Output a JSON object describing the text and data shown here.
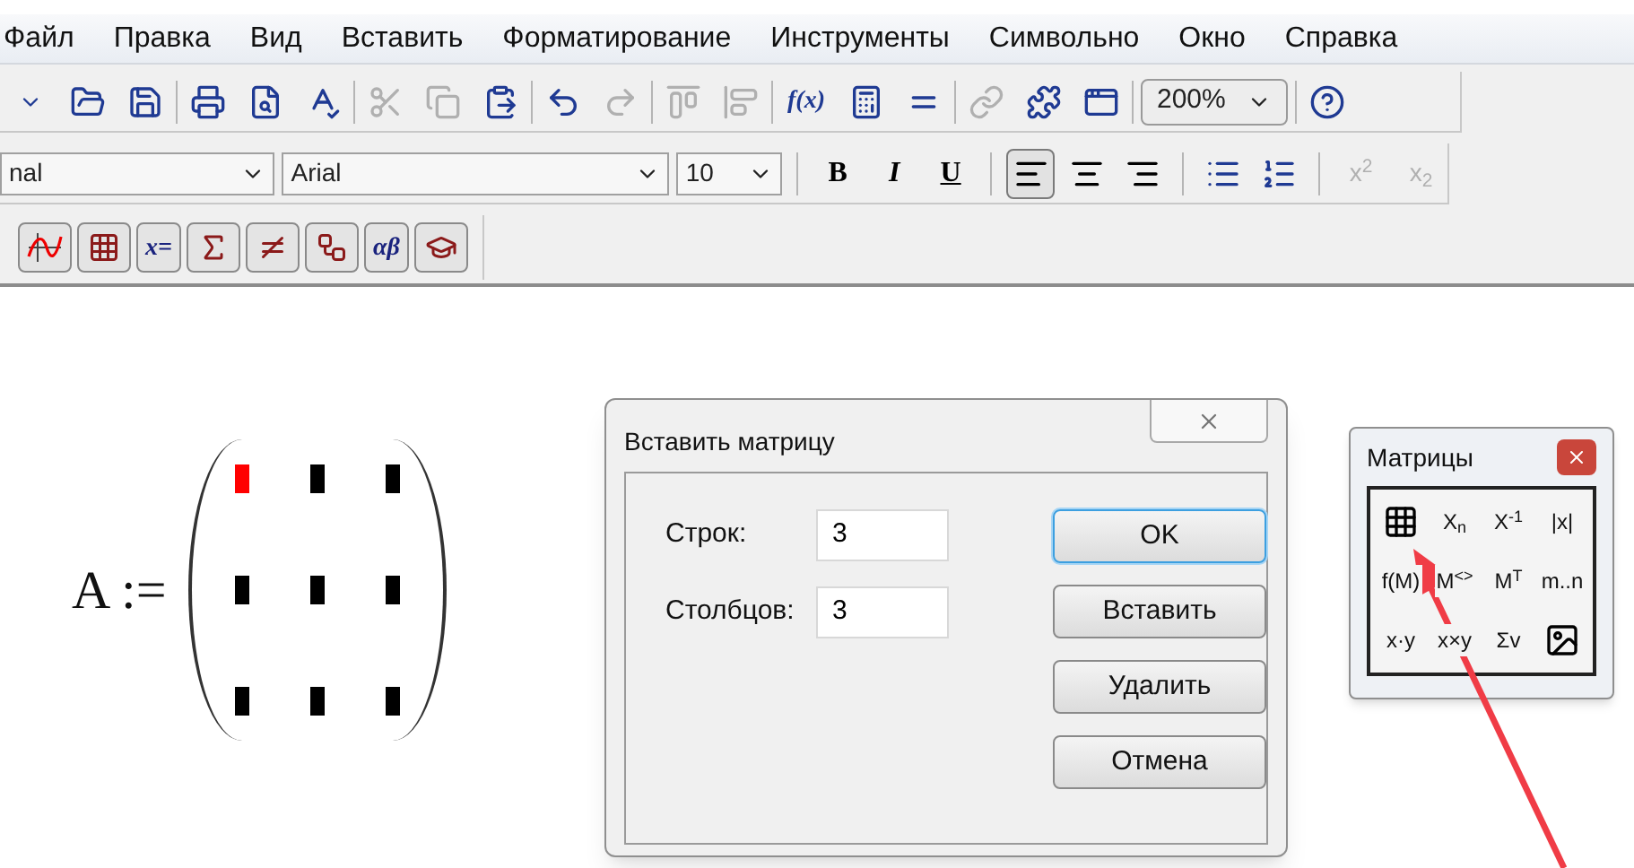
{
  "menu": [
    "Файл",
    "Правка",
    "Вид",
    "Вставить",
    "Форматирование",
    "Инструменты",
    "Символьно",
    "Окно",
    "Справка"
  ],
  "standard_toolbar": {
    "groups": [
      [
        {
          "kind": "dropdown",
          "disabled": false
        },
        {
          "kind": "open",
          "disabled": false
        },
        {
          "kind": "save",
          "disabled": false
        }
      ],
      [
        {
          "kind": "print",
          "disabled": false
        },
        {
          "kind": "preview",
          "disabled": false
        },
        {
          "kind": "spell",
          "disabled": false
        }
      ],
      [
        {
          "kind": "cut",
          "disabled": true
        },
        {
          "kind": "copy",
          "disabled": true
        },
        {
          "kind": "paste",
          "disabled": false
        }
      ],
      [
        {
          "kind": "undo",
          "disabled": false
        },
        {
          "kind": "redo",
          "disabled": true
        }
      ],
      [
        {
          "kind": "align_top",
          "disabled": true
        },
        {
          "kind": "align_left",
          "disabled": true
        }
      ],
      [
        {
          "kind": "text",
          "label": "f(x)",
          "disabled": false
        },
        {
          "kind": "resource",
          "disabled": false
        },
        {
          "kind": "equal",
          "disabled": false
        }
      ],
      [
        {
          "kind": "link",
          "disabled": true
        },
        {
          "kind": "component",
          "disabled": false
        },
        {
          "kind": "region",
          "disabled": false
        }
      ],
      [
        {
          "kind": "combo",
          "value": "200%",
          "disabled": false
        }
      ],
      [
        {
          "kind": "help",
          "disabled": false
        }
      ]
    ]
  },
  "formatting_toolbar": {
    "style": "nal",
    "font": "Arial",
    "size": "10",
    "text_buttons": [
      {
        "kind": "bold",
        "label": "B"
      },
      {
        "kind": "italic",
        "label": "I"
      },
      {
        "kind": "underline",
        "label": "U"
      }
    ],
    "align": [
      {
        "kind": "left",
        "selected": true
      },
      {
        "kind": "center",
        "selected": false
      },
      {
        "kind": "right",
        "selected": false
      }
    ],
    "lists": [
      {
        "kind": "bullets"
      },
      {
        "kind": "numbers"
      }
    ],
    "script": [
      {
        "label": "x$^{2}$",
        "disabled": true
      },
      {
        "label": "x$_{2}$",
        "disabled": true
      }
    ]
  },
  "math_toolbar": [
    {
      "kind": "graph"
    },
    {
      "kind": "matrix"
    },
    {
      "kind": "text",
      "label": "x="
    },
    {
      "kind": "calculus"
    },
    {
      "kind": "boolean"
    },
    {
      "kind": "programming"
    },
    {
      "kind": "text",
      "label": "αβ"
    },
    {
      "kind": "symbolic"
    }
  ],
  "worksheet": {
    "variable": "A :=",
    "matrix": [
      [
        {
          "selected": true
        },
        {
          "selected": false
        },
        {
          "selected": false
        }
      ],
      [
        {
          "selected": false
        },
        {
          "selected": false
        },
        {
          "selected": false
        }
      ],
      [
        {
          "selected": false
        },
        {
          "selected": false
        },
        {
          "selected": false
        }
      ]
    ]
  },
  "dialog": {
    "title": "Вставить матрицу",
    "fields": [
      {
        "label": "Строк:",
        "value": "3"
      },
      {
        "label": "Столбцов:",
        "value": "3"
      }
    ],
    "buttons": [
      {
        "label": "OK",
        "focused": true
      },
      {
        "label": "Вставить",
        "focused": false
      },
      {
        "label": "Удалить",
        "focused": false
      },
      {
        "label": "Отмена",
        "focused": false
      }
    ]
  },
  "palette": {
    "title": "Матрицы",
    "buttons": [
      {
        "kind": "matrix"
      },
      {
        "kind": "text",
        "label": "X$_{n}$"
      },
      {
        "kind": "text",
        "label": "X$^{-1}$"
      },
      {
        "kind": "text",
        "label": "|x|"
      },
      {
        "kind": "text",
        "label": "f(M)"
      },
      {
        "kind": "text",
        "label": "M$^{<>}$"
      },
      {
        "kind": "text",
        "label": "M$^{T}$"
      },
      {
        "kind": "text",
        "label": "m..n"
      },
      {
        "kind": "text",
        "label": "x·y"
      },
      {
        "kind": "text",
        "label": "x×y"
      },
      {
        "kind": "text",
        "label": "Σv"
      },
      {
        "kind": "picture"
      }
    ]
  }
}
